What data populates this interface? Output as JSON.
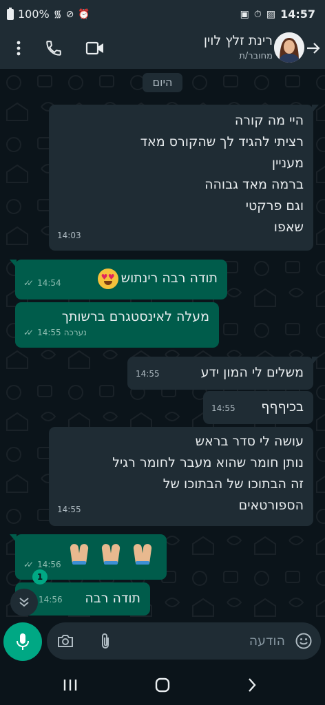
{
  "status_bar": {
    "battery": "100%",
    "time": "14:57"
  },
  "header": {
    "contact_name": "רינת זלץ לוין",
    "contact_status": "מחובר/ת"
  },
  "chat": {
    "date_chip": "היום",
    "messages": [
      {
        "direction": "in",
        "lines": [
          "היי מה קורה",
          "רציתי להגיד לך שהקורס מאד",
          "מעניין",
          "ברמה מאד גבוהה",
          "וגם פרקטי",
          "שאפו"
        ],
        "time": "14:03"
      },
      {
        "direction": "out",
        "text": "תודה רבה רינתוש",
        "emoji": "heart-eyes-emoji",
        "time": "14:54",
        "status": "read"
      },
      {
        "direction": "out",
        "text": "מעלה לאינסטגרם ברשותך",
        "time": "14:55",
        "edited_label": "נערכה",
        "status": "read"
      },
      {
        "direction": "in",
        "text": "משלים לי המון ידע",
        "time": "14:55"
      },
      {
        "direction": "in",
        "text": "בכיףףף",
        "time": "14:55"
      },
      {
        "direction": "in",
        "lines": [
          "עושה לי סדר בראש",
          "נותן חומר שהוא מעבר לחומר רגיל",
          "זה הבתוכו של הבתוכו של",
          "הספורטאים"
        ],
        "time": "14:55"
      },
      {
        "direction": "out",
        "emoji": "folded-hands-emoji",
        "emoji_count": 3,
        "time": "14:56",
        "status": "read"
      },
      {
        "direction": "out",
        "text": "תודה רבה",
        "time": "14:56",
        "status": "read"
      }
    ],
    "unread_count": "1"
  },
  "input_bar": {
    "placeholder": "הודעה"
  },
  "colors": {
    "background": "#0b141a",
    "bar": "#1f2c34",
    "incoming": "#1f2c34",
    "outgoing": "#005c4b",
    "accent": "#00a884",
    "text": "#e9edef",
    "meta": "#aebac1"
  }
}
